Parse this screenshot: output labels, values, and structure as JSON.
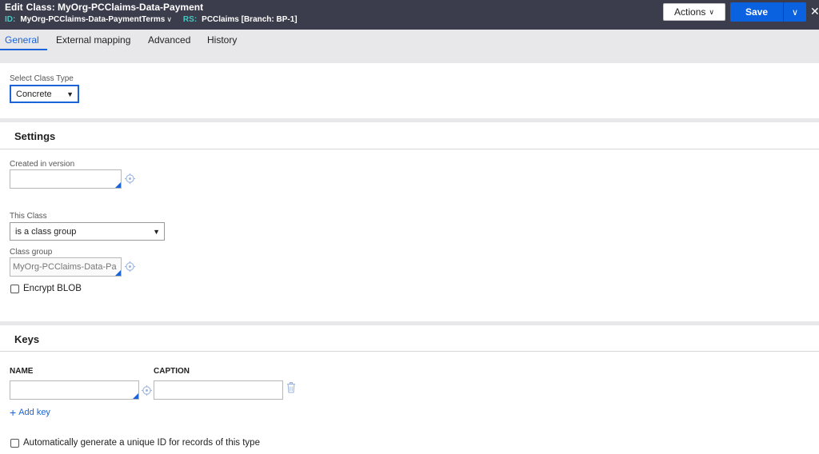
{
  "header": {
    "edit_label": "Edit",
    "title": "Class: MyOrg-PCClaims-Data-Payment",
    "id_label": "ID:",
    "id_value": "MyOrg-PCClaims-Data-PaymentTerms",
    "rs_label": "RS:",
    "rs_value": "PCClaims [Branch: BP-1]",
    "actions_label": "Actions",
    "save_label": "Save"
  },
  "tabs": [
    {
      "label": "General",
      "active": true
    },
    {
      "label": "External mapping",
      "active": false
    },
    {
      "label": "Advanced",
      "active": false
    },
    {
      "label": "History",
      "active": false
    }
  ],
  "class_type": {
    "label": "Select Class Type",
    "value": "Concrete"
  },
  "settings": {
    "title": "Settings",
    "created_in_version_label": "Created in version",
    "created_in_version_value": "",
    "this_class_label": "This Class",
    "this_class_value": "is a class group",
    "class_group_label": "Class group",
    "class_group_value": "MyOrg-PCClaims-Data-Pa",
    "encrypt_blob_label": "Encrypt BLOB",
    "encrypt_blob_checked": false
  },
  "keys": {
    "title": "Keys",
    "name_header": "NAME",
    "caption_header": "CAPTION",
    "name_value": "",
    "caption_value": "",
    "add_key_label": "Add key",
    "auto_id_label": "Automatically generate a unique ID for records of this type",
    "auto_id_checked": false
  },
  "colors": {
    "header_bg": "#3b3d4c",
    "accent": "#1a63d8",
    "save_bg": "#0b62e1",
    "id_label": "#47c7c1"
  }
}
